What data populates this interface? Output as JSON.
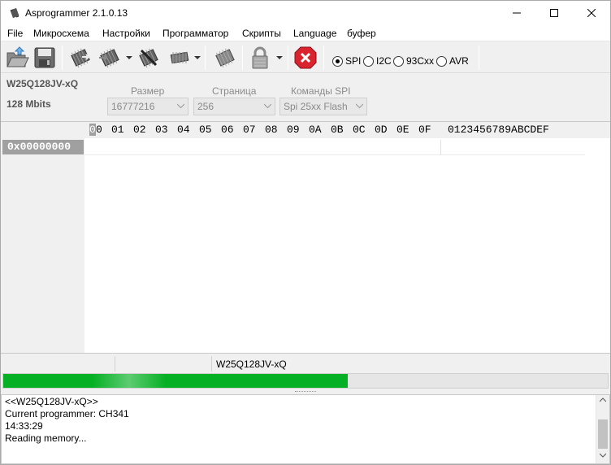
{
  "window": {
    "title": "Asprogrammer 2.1.0.13"
  },
  "menu": [
    "File",
    "Микросхема",
    "Настройки",
    "Программатор",
    "Скрипты",
    "Language",
    "буфер"
  ],
  "toolbar": {
    "buttons": [
      "open-icon",
      "save-icon",
      "read-chip-icon",
      "write-chip-icon",
      "verify-chip-icon",
      "erase-chip-icon",
      "blank-check-icon",
      "lock-icon",
      "stop-icon"
    ],
    "protocols": [
      {
        "label": "SPI",
        "selected": true
      },
      {
        "label": "I2C",
        "selected": false
      },
      {
        "label": "93Cxx",
        "selected": false
      },
      {
        "label": "AVR",
        "selected": false
      }
    ]
  },
  "chip": {
    "name": "W25Q128JV-xQ",
    "size": "128 Mbits"
  },
  "fields": {
    "size_label": "Размер",
    "size_value": "16777216",
    "page_label": "Страница",
    "page_value": "256",
    "commands_label": "Команды SPI",
    "commands_value": "Spi 25xx Flash"
  },
  "hex": {
    "columns": [
      "0",
      "0",
      "01",
      "02",
      "03",
      "04",
      "05",
      "06",
      "07",
      "08",
      "09",
      "0A",
      "0B",
      "0C",
      "0D",
      "0E",
      "0F"
    ],
    "ascii_header": "0123456789ABCDEF",
    "address": "0x00000000"
  },
  "status": {
    "chip": "W25Q128JV-xQ"
  },
  "progress": {
    "fraction": 0.57
  },
  "log": [
    "<<W25Q128JV-xQ>>",
    "Current programmer: CH341",
    "14:33:29",
    "Reading memory..."
  ],
  "colors": {
    "progress": "#06b025",
    "stop": "#d9232e",
    "cursor": "#a0a0a0"
  }
}
